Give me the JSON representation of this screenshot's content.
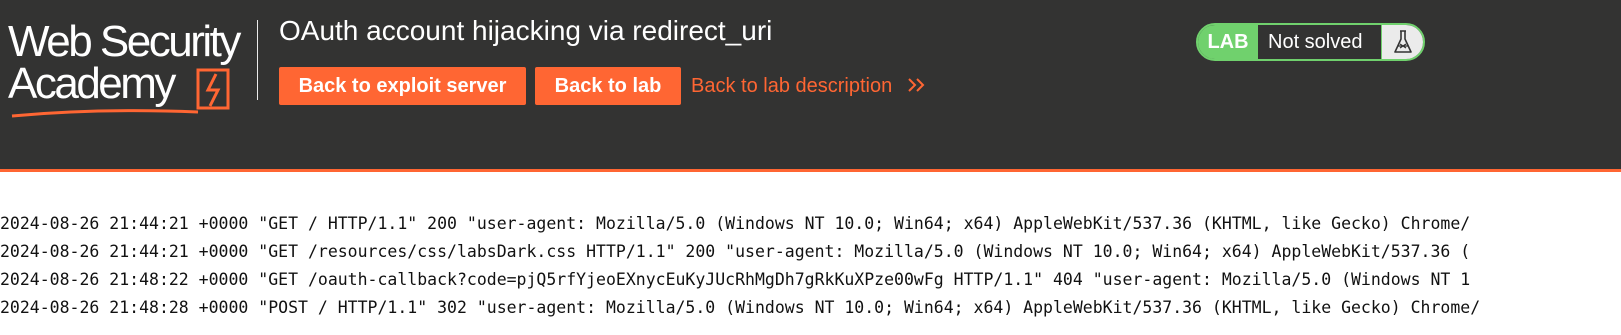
{
  "brand": {
    "line1": "Web Security",
    "line2": "Academy",
    "logo_icon": "lightning-bolt-icon",
    "color_text": "#ffffff",
    "color_accent": "#ff6633"
  },
  "header": {
    "background": "#333332",
    "title": "OAuth account hijacking via redirect_uri",
    "buttons": {
      "exploit_server": "Back to exploit server",
      "lab": "Back to lab"
    },
    "lab_description_link": "Back to lab description",
    "lab_description_icon": "double-chevron-right-icon"
  },
  "lab_status": {
    "badge": "LAB",
    "text": "Not solved",
    "icon": "flask-icon",
    "color_badge": "#70d16d"
  },
  "log": {
    "lines": [
      "2024-08-26 21:44:21 +0000 \"GET / HTTP/1.1\" 200 \"user-agent: Mozilla/5.0 (Windows NT 10.0; Win64; x64) AppleWebKit/537.36 (KHTML, like Gecko) Chrome/",
      "2024-08-26 21:44:21 +0000 \"GET /resources/css/labsDark.css HTTP/1.1\" 200 \"user-agent: Mozilla/5.0 (Windows NT 10.0; Win64; x64) AppleWebKit/537.36 (",
      "2024-08-26 21:48:22 +0000 \"GET /oauth-callback?code=pjQ5rfYjeoEXnycEuKyJUcRhMgDh7gRkKuXPze00wFg HTTP/1.1\" 404 \"user-agent: Mozilla/5.0 (Windows NT 1",
      "2024-08-26 21:48:28 +0000 \"POST / HTTP/1.1\" 302 \"user-agent: Mozilla/5.0 (Windows NT 10.0; Win64; x64) AppleWebKit/537.36 (KHTML, like Gecko) Chrome/"
    ]
  }
}
